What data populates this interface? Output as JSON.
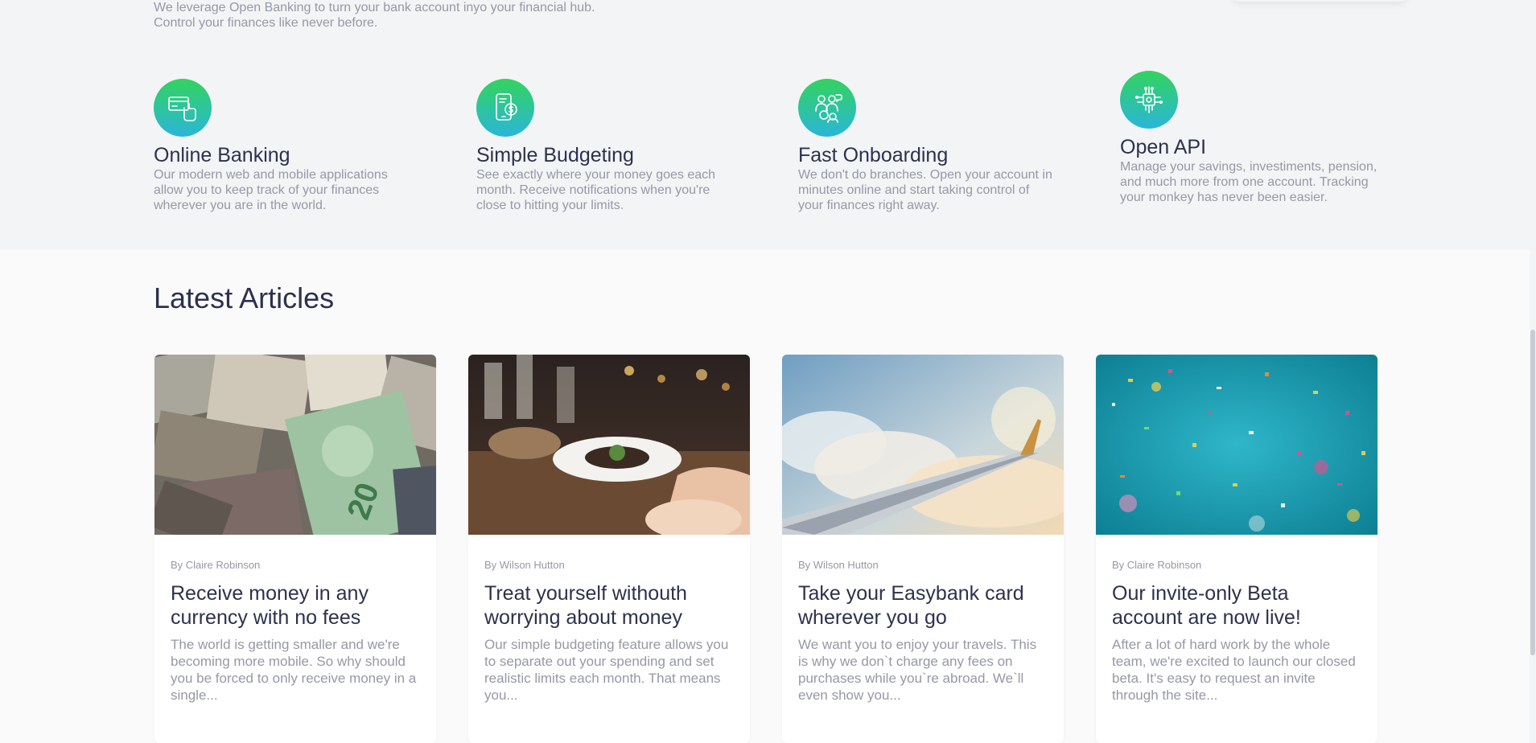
{
  "intro": {
    "line1": "We leverage Open Banking to turn your bank account inyo your financial hub.",
    "line2": "Control your finances like never before."
  },
  "features": [
    {
      "title": "Online Banking",
      "desc": "Our modern web and mobile applications allow you to keep track of your finances wherever you are in the world.",
      "icon": "online-banking-icon"
    },
    {
      "title": "Simple Budgeting",
      "desc": "See exactly where your money goes each month. Receive notifications when you're close to hitting your limits.",
      "icon": "budgeting-icon"
    },
    {
      "title": "Fast Onboarding",
      "desc": "We don't do branches. Open your account in minutes online and start taking control of your finances right away.",
      "icon": "onboarding-icon"
    },
    {
      "title": "Open API",
      "desc": "Manage your savings, investiments, pension, and much more from one account. Tracking your monkey has never been easier.",
      "icon": "api-icon"
    }
  ],
  "articles_section": {
    "title": "Latest Articles",
    "items": [
      {
        "author": "By Claire Robinson",
        "title": "Receive money in any currency with no fees",
        "desc": "The world is getting smaller and we're becoming more mobile. So why should you be forced to only receive money in a single..."
      },
      {
        "author": "By Wilson Hutton",
        "title": "Treat yourself withouth worrying about money",
        "desc": "Our simple budgeting feature allows you to separate out your spending and set realistic limits each month. That means you..."
      },
      {
        "author": "By Wilson Hutton",
        "title": "Take your Easybank card wherever you go",
        "desc": "We want you to enjoy your travels. This is why we don`t charge any fees on purchases while you`re abroad. We`ll even show you..."
      },
      {
        "author": "By Claire Robinson",
        "title": "Our invite-only Beta account are now live!",
        "desc": "After a lot of hard work by the whole team, we're excited to launch our closed beta. It's easy to request an invite through the site..."
      }
    ]
  },
  "colors": {
    "accent_green": "#33d35e",
    "accent_cyan": "#2ab6d9",
    "dark_blue": "#2d314d",
    "grayish_blue": "#9698a6"
  }
}
